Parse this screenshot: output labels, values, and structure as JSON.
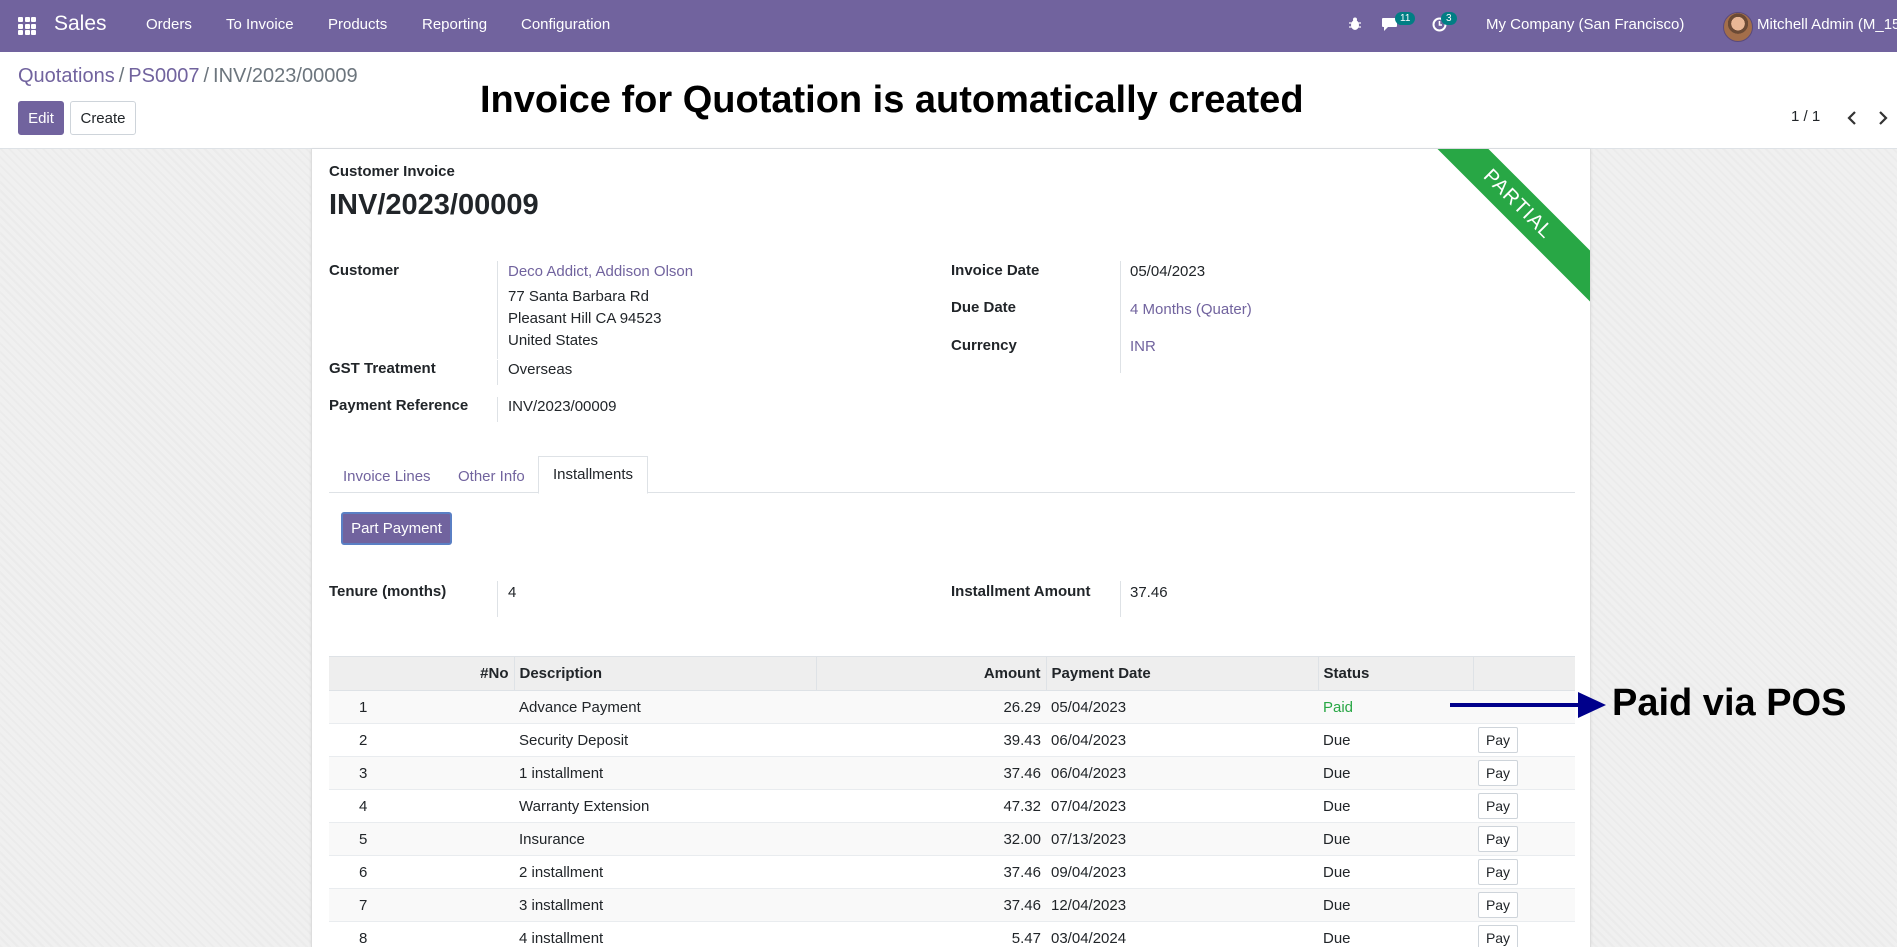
{
  "navbar": {
    "app_name": "Sales",
    "menu": [
      "Orders",
      "To Invoice",
      "Products",
      "Reporting",
      "Configuration"
    ],
    "chat_count": "11",
    "activity_count": "3",
    "company": "My Company (San Francisco)",
    "user": "Mitchell Admin (M_15"
  },
  "breadcrumb": [
    "Quotations",
    "PS0007",
    "INV/2023/00009"
  ],
  "buttons": {
    "edit": "Edit",
    "create": "Create"
  },
  "annotations": {
    "heading": "Invoice for Quotation is automatically created",
    "paid": "Paid via POS"
  },
  "pager": {
    "value": "1 / 1"
  },
  "invoice": {
    "type_label": "Customer Invoice",
    "name": "INV/2023/00009",
    "ribbon": "PARTIAL",
    "customer_label": "Customer",
    "customer_name": "Deco Addict, Addison Olson",
    "address": [
      "77 Santa Barbara Rd",
      "Pleasant Hill CA 94523",
      "United States"
    ],
    "gst_label": "GST Treatment",
    "gst_value": "Overseas",
    "payment_ref_label": "Payment Reference",
    "payment_ref_value": "INV/2023/00009",
    "invoice_date_label": "Invoice Date",
    "invoice_date_value": "05/04/2023",
    "due_date_label": "Due Date",
    "due_date_value": "4 Months (Quater)",
    "currency_label": "Currency",
    "currency_value": "INR"
  },
  "tabs": [
    "Invoice Lines",
    "Other Info",
    "Installments"
  ],
  "installments": {
    "part_payment_label": "Part Payment",
    "tenure_label": "Tenure (months)",
    "tenure_value": "4",
    "amount_label": "Installment Amount",
    "amount_value": "37.46",
    "columns": [
      "#No",
      "Description",
      "Amount",
      "Payment Date",
      "Status",
      ""
    ],
    "pay_label": "Pay",
    "rows": [
      {
        "no": "1",
        "description": "Advance Payment",
        "amount": "26.29",
        "date": "05/04/2023",
        "status": "Paid"
      },
      {
        "no": "2",
        "description": "Security Deposit",
        "amount": "39.43",
        "date": "06/04/2023",
        "status": "Due"
      },
      {
        "no": "3",
        "description": "1 installment",
        "amount": "37.46",
        "date": "06/04/2023",
        "status": "Due"
      },
      {
        "no": "4",
        "description": "Warranty Extension",
        "amount": "47.32",
        "date": "07/04/2023",
        "status": "Due"
      },
      {
        "no": "5",
        "description": "Insurance",
        "amount": "32.00",
        "date": "07/13/2023",
        "status": "Due"
      },
      {
        "no": "6",
        "description": "2 installment",
        "amount": "37.46",
        "date": "09/04/2023",
        "status": "Due"
      },
      {
        "no": "7",
        "description": "3 installment",
        "amount": "37.46",
        "date": "12/04/2023",
        "status": "Due"
      },
      {
        "no": "8",
        "description": "4 installment",
        "amount": "5.47",
        "date": "03/04/2024",
        "status": "Due"
      }
    ]
  },
  "colors": {
    "brand": "#71639e",
    "ribbon": "#28a745",
    "paid": "#28a745",
    "arrow": "#00008b"
  }
}
